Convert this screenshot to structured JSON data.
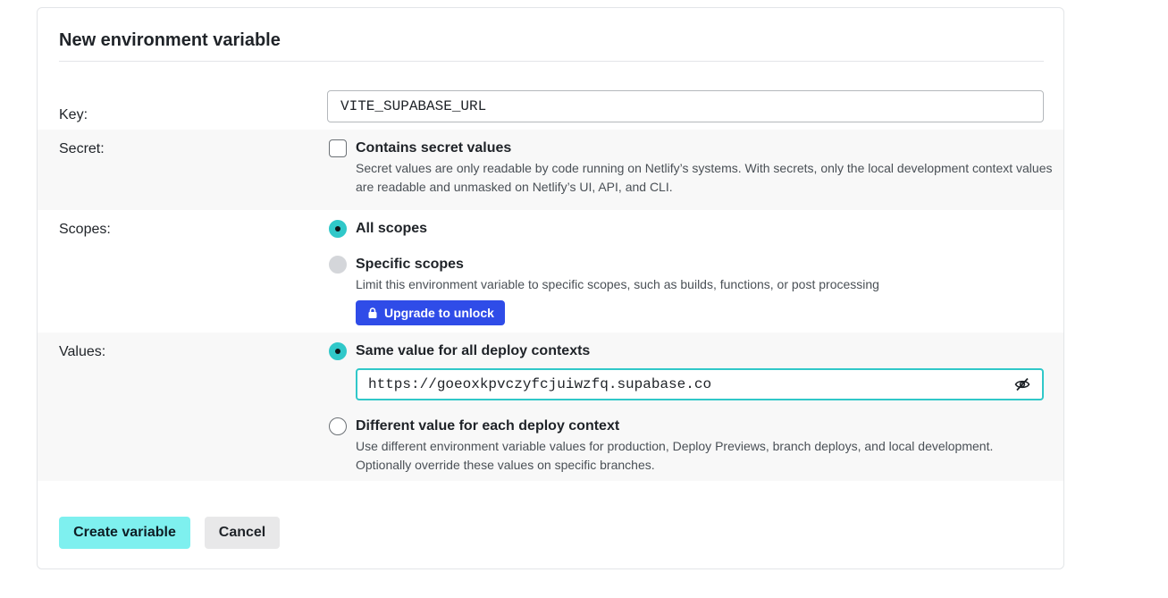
{
  "form": {
    "title": "New environment variable"
  },
  "key": {
    "label": "Key:",
    "value": "VITE_SUPABASE_URL"
  },
  "secret": {
    "label": "Secret:",
    "checkbox_label": "Contains secret values",
    "checked": false,
    "description": "Secret values are only readable by code running on Netlify’s systems. With secrets, only the local development context values are readable and unmasked on Netlify’s UI, API, and CLI."
  },
  "scopes": {
    "label": "Scopes:",
    "all_label": "All scopes",
    "specific_label": "Specific scopes",
    "specific_description": "Limit this environment variable to specific scopes, such as builds, functions, or post processing",
    "upgrade_label": "Upgrade to unlock",
    "upgrade_icon": "lock-icon"
  },
  "values": {
    "label": "Values:",
    "same_label": "Same value for all deploy contexts",
    "value": "https://goeoxkpvczyfcjuiwzfq.supabase.co",
    "reveal_icon": "eye-slash-icon",
    "different_label": "Different value for each deploy context",
    "different_description": "Use different environment variable values for production, Deploy Previews, branch deploys, and local development. Optionally override these values on specific branches."
  },
  "actions": {
    "create_label": "Create variable",
    "cancel_label": "Cancel"
  },
  "colors": {
    "accent": "#30c8c9",
    "primary_button": "#7ef0ef",
    "upgrade_button": "#2f4ce8"
  }
}
